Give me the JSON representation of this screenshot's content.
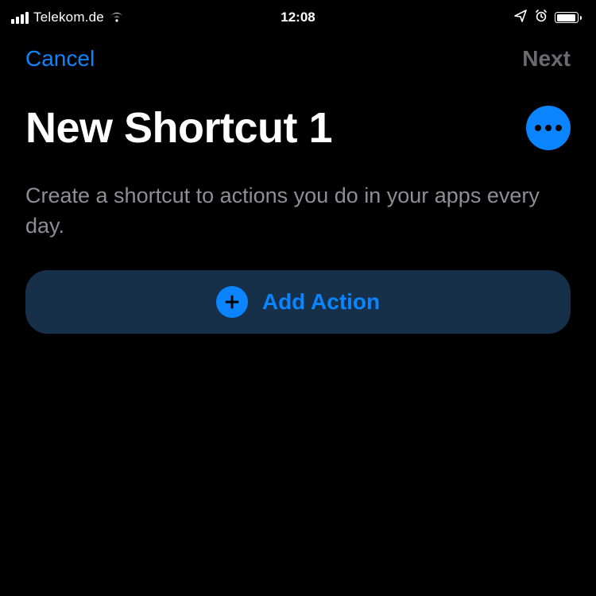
{
  "statusBar": {
    "carrier": "Telekom.de",
    "time": "12:08"
  },
  "nav": {
    "cancel": "Cancel",
    "next": "Next"
  },
  "title": "New Shortcut 1",
  "description": "Create a shortcut to actions you do in your apps every day.",
  "addAction": "Add Action",
  "colors": {
    "accent": "#0a84ff",
    "addActionBg": "#16304a",
    "secondaryText": "#8e8e93",
    "disabledText": "#6b6b6f"
  }
}
